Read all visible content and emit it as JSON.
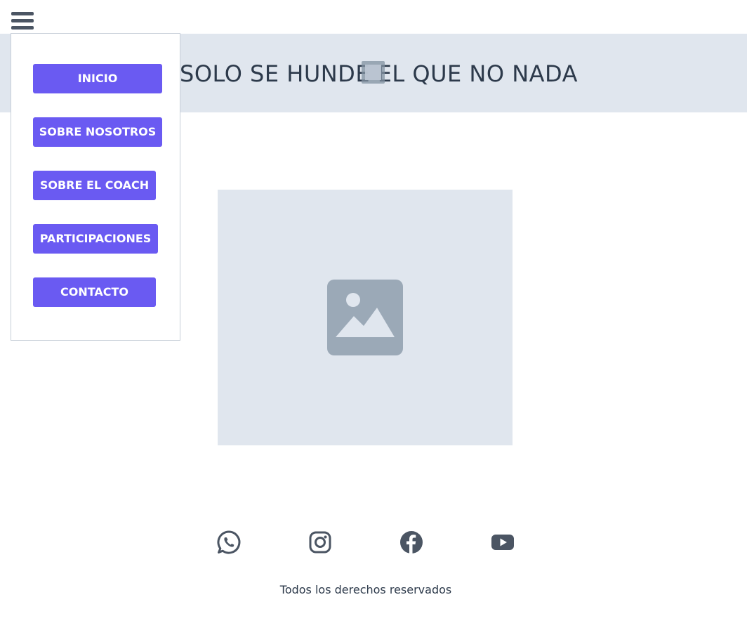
{
  "header": {
    "menu_icon": "hamburger-menu-icon"
  },
  "banner": {
    "title": "SOLO SE HUNDE EL QUE NO NADA",
    "image_icon": "broken-image-icon"
  },
  "menu": {
    "items": [
      {
        "label": "INICIO"
      },
      {
        "label": "SOBRE NOSOTROS"
      },
      {
        "label": "SOBRE EL COACH"
      },
      {
        "label": "PARTICIPACIONES"
      },
      {
        "label": "CONTACTO"
      }
    ]
  },
  "main": {
    "image_icon": "image-placeholder-icon"
  },
  "social": {
    "icons": [
      "whatsapp-icon",
      "instagram-icon",
      "facebook-icon",
      "youtube-icon"
    ]
  },
  "footer": {
    "text": "Todos los derechos reservados"
  },
  "colors": {
    "accent": "#6a5af2",
    "banner_bg": "#e0e6ee",
    "text": "#2d3a4b",
    "icon": "#4b5563"
  }
}
